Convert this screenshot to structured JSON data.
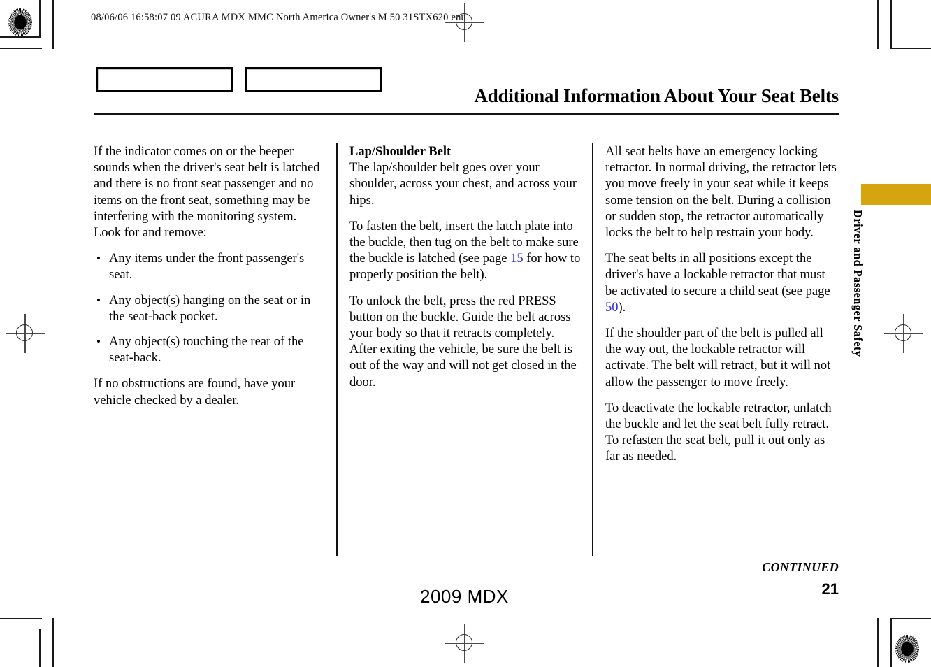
{
  "print_slug": "08/06/06 16:58:07   09 ACURA MDX MMC North America Owner's M 50 31STX620 enu",
  "header": {
    "title": "Additional Information About Your Seat Belts",
    "box_1_label": "",
    "box_2_label": ""
  },
  "side_tab": {
    "label": "Driver and Passenger Safety",
    "color": "#d6a411"
  },
  "columns": {
    "col1": {
      "para_1": "If the indicator comes on or the beeper sounds when the driver's seat belt is latched and there is no front seat passenger and no items on the front seat, something may be interfering with the monitoring system. Look for and remove:",
      "bullets": [
        "Any items under the front passenger's seat.",
        "Any object(s) hanging on the seat or in the seat-back pocket.",
        "Any object(s) touching the rear of the seat-back."
      ],
      "para_2": "If no obstructions are found, have your vehicle checked by a dealer."
    },
    "col2": {
      "heading": "Lap/Shoulder Belt",
      "para_1": "The lap/shoulder belt goes over your shoulder, across your chest, and across your hips.",
      "para_2_before": "To fasten the belt, insert the latch plate into the buckle, then tug on the belt to make sure the buckle is latched (see page ",
      "para_2_xref": "15",
      "para_2_after": " for how to properly position the belt).",
      "para_3": "To unlock the belt, press the red PRESS button on the buckle. Guide the belt across your body so that it retracts completely. After exiting the vehicle, be sure the belt is out of the way and will not get closed in the door."
    },
    "col3": {
      "para_1": "All seat belts have an emergency locking retractor. In normal driving, the retractor lets you move freely in your seat while it keeps some tension on the belt. During a collision or sudden stop, the retractor automatically locks the belt to help restrain your body.",
      "para_2_before": "The seat belts in all positions except the driver's have a lockable retractor that must be activated to secure a child seat (see page ",
      "para_2_xref": "50",
      "para_2_after": ").",
      "para_3": "If the shoulder part of the belt is pulled all the way out, the lockable retractor will activate. The belt will retract, but it will not allow the passenger to move freely.",
      "para_4": "To deactivate the lockable retractor, unlatch the buckle and let the seat belt fully retract. To refasten the seat belt, pull it out only as far as needed."
    }
  },
  "footer": {
    "continued": "CONTINUED",
    "page_number": "21",
    "model": "2009  MDX"
  }
}
